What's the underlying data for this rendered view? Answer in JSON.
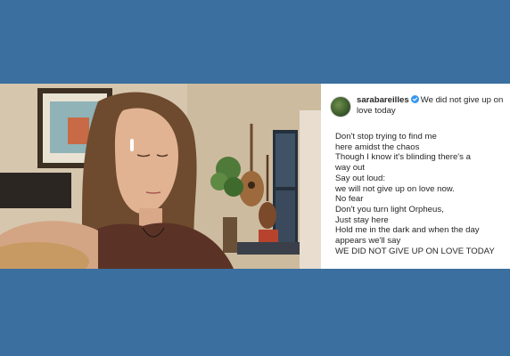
{
  "post": {
    "username": "sarabareilles",
    "caption_first_line": "We did not give up on",
    "caption_second_line": "love today",
    "lyrics": [
      "Don't stop trying to find me",
      "here amidst the chaos",
      "Though I know it's blinding there's a",
      "way out",
      "Say out loud:",
      "we will not give up on love now.",
      "No fear",
      "Don't you turn light Orpheus,",
      "Just stay here",
      "Hold me in the dark and when the day",
      "appears we'll say",
      "WE DID NOT GIVE UP ON LOVE TODAY"
    ]
  },
  "icons": {
    "avatar": "profile-avatar",
    "verified": "verified-badge-icon"
  },
  "colors": {
    "background": "#3a6f9f",
    "verified": "#3897f0"
  }
}
